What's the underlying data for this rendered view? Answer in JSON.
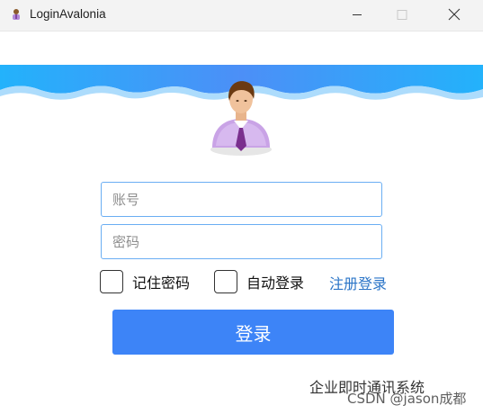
{
  "window": {
    "title": "LoginAvalonia",
    "icon": "avalonia-app-icon",
    "controls": [
      "minimize-icon",
      "maximize-icon",
      "close-icon"
    ]
  },
  "banner": {
    "colors": {
      "top": "#23a7f8",
      "wave": "#8fd0fb"
    }
  },
  "avatar": {
    "icon": "user-avatar-icon"
  },
  "form": {
    "account_placeholder": "账号",
    "account_value": "",
    "password_placeholder": "密码",
    "password_value": "",
    "remember_label": "记住密码",
    "remember_checked": false,
    "autologin_label": "自动登录",
    "autologin_checked": false,
    "register_label": "注册登录",
    "login_label": "登录"
  },
  "footer": {
    "system_name": "企业即时通讯系统",
    "watermark": "CSDN @jason成都"
  },
  "colors": {
    "accent": "#3d84f7",
    "input_border": "#6aaef3",
    "link": "#2a74c7"
  }
}
